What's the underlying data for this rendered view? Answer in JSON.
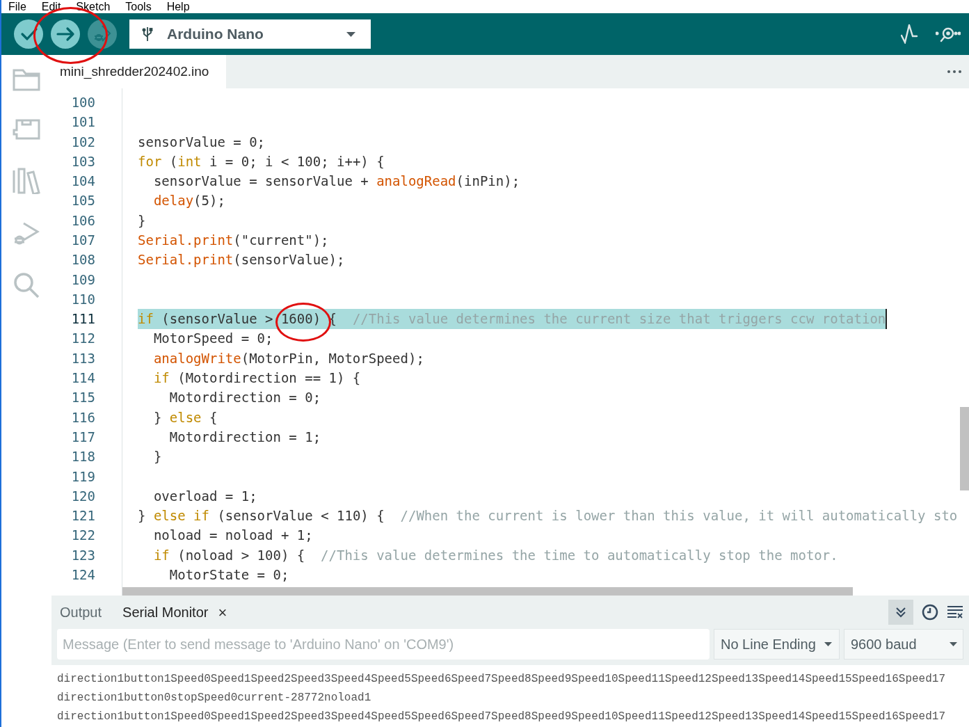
{
  "menu": [
    "File",
    "Edit",
    "Sketch",
    "Tools",
    "Help"
  ],
  "toolbar": {
    "buttons": [
      {
        "kind": "verify",
        "disabled": false
      },
      {
        "kind": "upload",
        "disabled": false
      },
      {
        "kind": "debug",
        "disabled": true
      }
    ],
    "board": "Arduino Nano"
  },
  "editor_tab": {
    "label": "mini_shredder202402.ino",
    "selected": true
  },
  "code_lines": [
    {
      "number": "100",
      "current": false
    },
    {
      "number": "101",
      "current": false
    },
    {
      "number": "102",
      "current": false,
      "tokens": [
        {
          "kind": "plain",
          "text": "sensorValue = 0;"
        }
      ]
    },
    {
      "number": "103",
      "current": false,
      "tokens": [
        {
          "kind": "keyword",
          "text": "for"
        },
        {
          "kind": "plain",
          "text": " ("
        },
        {
          "kind": "keyword",
          "text": "int"
        },
        {
          "kind": "plain",
          "text": " i = 0; i < 100; i++) {"
        }
      ]
    },
    {
      "number": "104",
      "current": false,
      "tokens": [
        {
          "kind": "plain",
          "text": "  sensorValue = sensorValue + "
        },
        {
          "kind": "function",
          "text": "analogRead"
        },
        {
          "kind": "plain",
          "text": "(inPin);"
        }
      ]
    },
    {
      "number": "105",
      "current": false,
      "tokens": [
        {
          "kind": "function",
          "text": "  delay"
        },
        {
          "kind": "plain",
          "text": "(5);"
        }
      ]
    },
    {
      "number": "106",
      "current": false,
      "tokens": [
        {
          "kind": "plain",
          "text": "}"
        }
      ]
    },
    {
      "number": "107",
      "current": false,
      "tokens": [
        {
          "kind": "function",
          "text": "Serial.print"
        },
        {
          "kind": "plain",
          "text": "(\"current\");"
        }
      ]
    },
    {
      "number": "108",
      "current": false,
      "tokens": [
        {
          "kind": "function",
          "text": "Serial.print"
        },
        {
          "kind": "plain",
          "text": "(sensorValue);"
        }
      ]
    },
    {
      "number": "109",
      "current": false
    },
    {
      "number": "110",
      "current": false
    },
    {
      "number": "111",
      "current": true,
      "tokens": [
        {
          "kind": "keyword",
          "text": "if"
        },
        {
          "kind": "plain",
          "text": " (sensorValue > 1600) {  "
        },
        {
          "kind": "comment",
          "text": "//This value determines the current size that triggers ccw rotation"
        }
      ]
    },
    {
      "number": "112",
      "current": false,
      "tokens": [
        {
          "kind": "plain",
          "text": "  MotorSpeed = 0;"
        }
      ]
    },
    {
      "number": "113",
      "current": false,
      "tokens": [
        {
          "kind": "function",
          "text": "  analogWrite"
        },
        {
          "kind": "plain",
          "text": "(MotorPin, MotorSpeed);"
        }
      ]
    },
    {
      "number": "114",
      "current": false,
      "tokens": [
        {
          "kind": "keyword",
          "text": "  if"
        },
        {
          "kind": "plain",
          "text": " (Motordirection == 1) {"
        }
      ]
    },
    {
      "number": "115",
      "current": false,
      "tokens": [
        {
          "kind": "plain",
          "text": "    Motordirection = 0;"
        }
      ]
    },
    {
      "number": "116",
      "current": false,
      "tokens": [
        {
          "kind": "plain",
          "text": "  } "
        },
        {
          "kind": "keyword",
          "text": "else"
        },
        {
          "kind": "plain",
          "text": " {"
        }
      ]
    },
    {
      "number": "117",
      "current": false,
      "tokens": [
        {
          "kind": "plain",
          "text": "    Motordirection = 1;"
        }
      ]
    },
    {
      "number": "118",
      "current": false,
      "tokens": [
        {
          "kind": "plain",
          "text": "  }"
        }
      ]
    },
    {
      "number": "119",
      "current": false
    },
    {
      "number": "120",
      "current": false,
      "tokens": [
        {
          "kind": "plain",
          "text": "  overload = 1;"
        }
      ]
    },
    {
      "number": "121",
      "current": false,
      "tokens": [
        {
          "kind": "plain",
          "text": "} "
        },
        {
          "kind": "keyword",
          "text": "else"
        },
        {
          "kind": "keyword",
          "text": " if"
        },
        {
          "kind": "plain",
          "text": " (sensorValue < 110) {  "
        },
        {
          "kind": "comment",
          "text": "//When the current is lower than this value, it will automatically sto"
        }
      ]
    },
    {
      "number": "122",
      "current": false,
      "tokens": [
        {
          "kind": "plain",
          "text": "  noload = noload + 1;"
        }
      ]
    },
    {
      "number": "123",
      "current": false,
      "tokens": [
        {
          "kind": "keyword",
          "text": "  if"
        },
        {
          "kind": "plain",
          "text": " (noload > 100) {  "
        },
        {
          "kind": "comment",
          "text": "//This value determines the time to automatically stop the motor."
        }
      ]
    },
    {
      "number": "124",
      "current": false,
      "tokens": [
        {
          "kind": "plain",
          "text": "    MotorState = 0;"
        }
      ]
    }
  ],
  "panel_tabs": [
    {
      "label": "Output",
      "selected": false,
      "closable": false
    },
    {
      "label": "Serial Monitor",
      "selected": true,
      "closable": true
    }
  ],
  "close_glyph": "×",
  "panel_tools": {
    "autoscroll_on": true
  },
  "message": {
    "placeholder": "Message (Enter to send message to 'Arduino Nano' on 'COM9')"
  },
  "line_ending": "No Line Ending",
  "baud": "9600 baud",
  "serial_lines": [
    "direction1button1Speed0Speed1Speed2Speed3Speed4Speed5Speed6Speed7Speed8Speed9Speed10Speed11Speed12Speed13Speed14Speed15Speed16Speed17",
    "direction1button0stopSpeed0current-28772noload1",
    "direction1button1Speed0Speed1Speed2Speed3Speed4Speed5Speed6Speed7Speed8Speed9Speed10Speed11Speed12Speed13Speed14Speed15Speed16Speed17"
  ]
}
